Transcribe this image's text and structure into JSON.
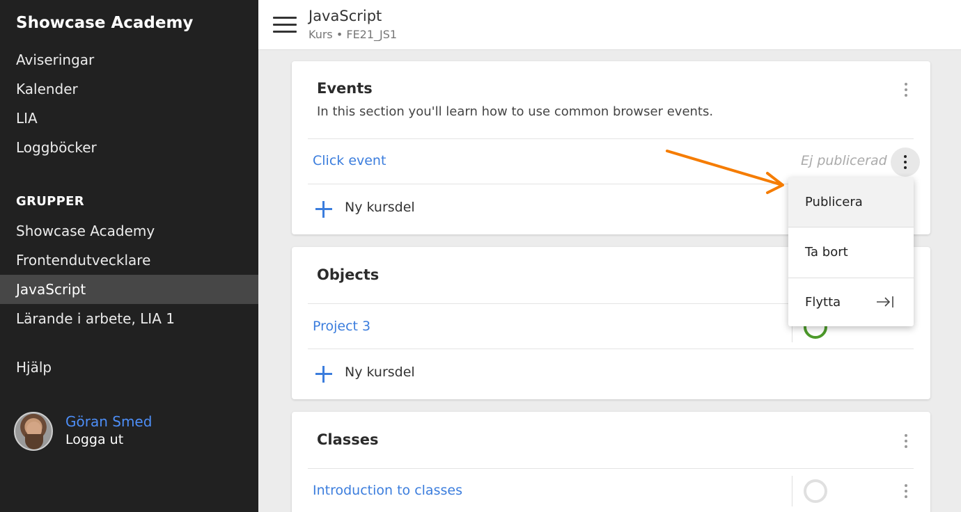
{
  "sidebar": {
    "brand": "Showcase Academy",
    "nav": [
      "Aviseringar",
      "Kalender",
      "LIA",
      "Loggböcker"
    ],
    "groups_heading": "GRUPPER",
    "groups": [
      "Showcase Academy",
      "Frontendutvecklare",
      "JavaScript",
      "Lärande i arbete, LIA 1"
    ],
    "active_group": "JavaScript",
    "help": "Hjälp",
    "user": {
      "name": "Göran Smed",
      "logout": "Logga ut"
    }
  },
  "header": {
    "title": "JavaScript",
    "subtitle": "Kurs • FE21_JS1"
  },
  "sections": [
    {
      "title": "Events",
      "description": "In this section you'll learn how to use common browser events.",
      "lessons": [
        {
          "title": "Click event",
          "status": "Ej publicerad"
        }
      ],
      "add_label": "Ny kursdel"
    },
    {
      "title": "Objects",
      "lessons": [
        {
          "title": "Project 3",
          "completed": true
        }
      ],
      "add_label": "Ny kursdel"
    },
    {
      "title": "Classes",
      "lessons": [
        {
          "title": "Introduction to classes",
          "completed": false
        }
      ]
    }
  ],
  "menu": {
    "items": [
      "Publicera",
      "Ta bort",
      "Flytta"
    ]
  },
  "colors": {
    "sidebar_bg": "#212121",
    "link": "#3b7ddd",
    "user_link": "#4d8ef7",
    "arrow": "#f57c00",
    "done_ring": "#4c9a2a"
  }
}
